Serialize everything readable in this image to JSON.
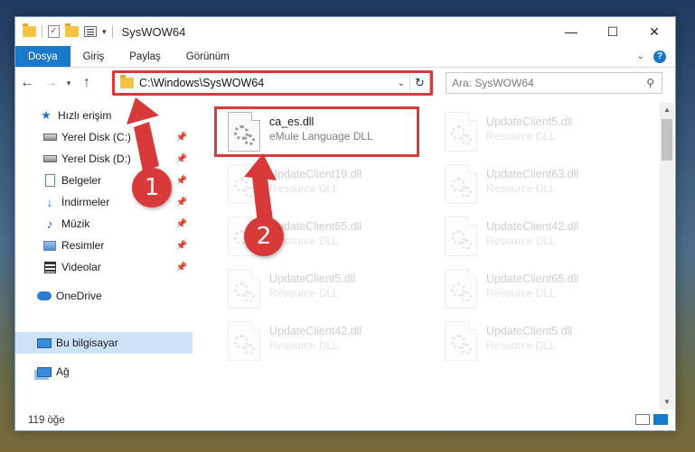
{
  "window": {
    "title": "SysWOW64",
    "controls": {
      "minimize": "—",
      "maximize": "☐",
      "close": "✕"
    }
  },
  "ribbon": {
    "tabs": [
      "Dosya",
      "Giriş",
      "Paylaş",
      "Görünüm"
    ]
  },
  "address": {
    "path": "C:\\Windows\\SysWOW64",
    "refresh_glyph": "↻"
  },
  "search": {
    "placeholder": "Ara: SysWOW64",
    "icon": "search-icon"
  },
  "sidebar": {
    "items": [
      {
        "label": "Hızlı erişim",
        "icon": "star-icon",
        "pinned": false
      },
      {
        "label": "Yerel Disk (C:)",
        "icon": "disk-icon",
        "pinned": true
      },
      {
        "label": "Yerel Disk (D:)",
        "icon": "disk-icon",
        "pinned": true
      },
      {
        "label": "Belgeler",
        "icon": "document-icon",
        "pinned": true
      },
      {
        "label": "İndirmeler",
        "icon": "download-icon",
        "pinned": true
      },
      {
        "label": "Müzik",
        "icon": "music-icon",
        "pinned": true
      },
      {
        "label": "Resimler",
        "icon": "pictures-icon",
        "pinned": true
      },
      {
        "label": "Videolar",
        "icon": "video-icon",
        "pinned": true
      },
      {
        "label": "OneDrive",
        "icon": "cloud-icon",
        "pinned": false
      },
      {
        "label": "Bu bilgisayar",
        "icon": "computer-icon",
        "pinned": false,
        "selected": true
      },
      {
        "label": "Ağ",
        "icon": "network-icon",
        "pinned": false
      }
    ]
  },
  "files": [
    {
      "name": "ca_es.dll",
      "desc": "eMule Language DLL",
      "highlighted": true
    },
    {
      "name": "UpdateClient5.dll",
      "desc": "Resource DLL"
    },
    {
      "name": "UpdateClient19.dll",
      "desc": "Resource DLL"
    },
    {
      "name": "UpdateClient63.dll",
      "desc": "Resource DLL"
    },
    {
      "name": "UpdateClient65.dll",
      "desc": "Resource DLL"
    },
    {
      "name": "UpdateClient42.dll",
      "desc": "Resource DLL"
    },
    {
      "name": "UpdateClient5.dll",
      "desc": "Resource DLL"
    },
    {
      "name": "UpdateClient65.dll",
      "desc": "Resource DLL"
    },
    {
      "name": "UpdateClient42.dll",
      "desc": "Resource DLL"
    },
    {
      "name": "UpdateClient5.dll",
      "desc": "Resource DLL"
    }
  ],
  "status": {
    "count": "119 öğe"
  },
  "annotations": {
    "marker1": "1",
    "marker2": "2",
    "color": "#d83a3a"
  }
}
